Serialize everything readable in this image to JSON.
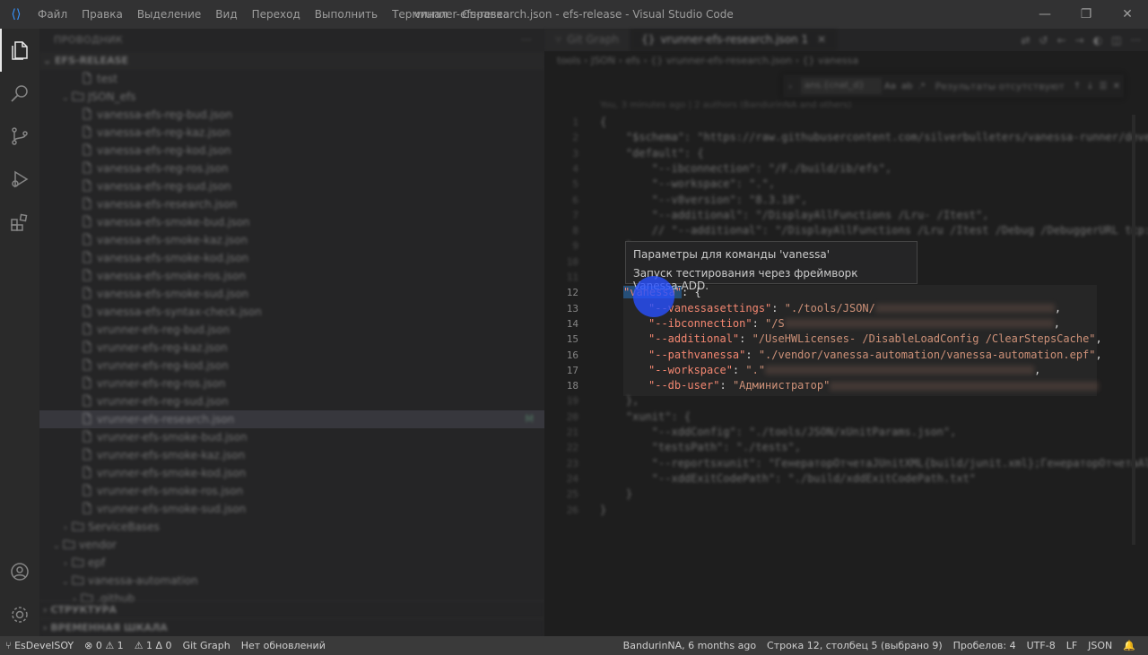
{
  "titlebar": {
    "menu": [
      "Файл",
      "Правка",
      "Выделение",
      "Вид",
      "Переход",
      "Выполнить",
      "Терминал",
      "Справка"
    ],
    "window_title": "vrunner-efs-research.json - efs-release - Visual Studio Code",
    "controls": [
      "—",
      "❐",
      "✕"
    ]
  },
  "activity": {
    "items": [
      "explorer-icon",
      "search-icon",
      "source-control-icon",
      "run-debug-icon",
      "extensions-icon"
    ],
    "bottom": [
      "account-icon",
      "settings-gear-icon"
    ]
  },
  "sidebar": {
    "header": "ПРОВОДНИК",
    "more": "···",
    "root": "EFS-RELEASE",
    "rows": [
      {
        "indent": 2,
        "chev": "",
        "label": "test"
      },
      {
        "indent": 1,
        "chev": "⌄",
        "label": "JSON_efs",
        "folder": true
      },
      {
        "indent": 2,
        "chev": "",
        "label": "vanessa-efs-reg-bud.json"
      },
      {
        "indent": 2,
        "chev": "",
        "label": "vanessa-efs-reg-kaz.json"
      },
      {
        "indent": 2,
        "chev": "",
        "label": "vanessa-efs-reg-kod.json"
      },
      {
        "indent": 2,
        "chev": "",
        "label": "vanessa-efs-reg-ros.json"
      },
      {
        "indent": 2,
        "chev": "",
        "label": "vanessa-efs-reg-sud.json"
      },
      {
        "indent": 2,
        "chev": "",
        "label": "vanessa-efs-research.json"
      },
      {
        "indent": 2,
        "chev": "",
        "label": "vanessa-efs-smoke-bud.json"
      },
      {
        "indent": 2,
        "chev": "",
        "label": "vanessa-efs-smoke-kaz.json"
      },
      {
        "indent": 2,
        "chev": "",
        "label": "vanessa-efs-smoke-kod.json"
      },
      {
        "indent": 2,
        "chev": "",
        "label": "vanessa-efs-smoke-ros.json"
      },
      {
        "indent": 2,
        "chev": "",
        "label": "vanessa-efs-smoke-sud.json"
      },
      {
        "indent": 2,
        "chev": "",
        "label": "vanessa-efs-syntax-check.json"
      },
      {
        "indent": 2,
        "chev": "",
        "label": "vrunner-efs-reg-bud.json"
      },
      {
        "indent": 2,
        "chev": "",
        "label": "vrunner-efs-reg-kaz.json"
      },
      {
        "indent": 2,
        "chev": "",
        "label": "vrunner-efs-reg-kod.json"
      },
      {
        "indent": 2,
        "chev": "",
        "label": "vrunner-efs-reg-ros.json"
      },
      {
        "indent": 2,
        "chev": "",
        "label": "vrunner-efs-reg-sud.json"
      },
      {
        "indent": 2,
        "chev": "",
        "label": "vrunner-efs-research.json",
        "selected": true,
        "badge": "M"
      },
      {
        "indent": 2,
        "chev": "",
        "label": "vrunner-efs-smoke-bud.json"
      },
      {
        "indent": 2,
        "chev": "",
        "label": "vrunner-efs-smoke-kaz.json"
      },
      {
        "indent": 2,
        "chev": "",
        "label": "vrunner-efs-smoke-kod.json"
      },
      {
        "indent": 2,
        "chev": "",
        "label": "vrunner-efs-smoke-ros.json"
      },
      {
        "indent": 2,
        "chev": "",
        "label": "vrunner-efs-smoke-sud.json"
      },
      {
        "indent": 1,
        "chev": "›",
        "label": "ServiceBases",
        "folder": true
      },
      {
        "indent": 0,
        "chev": "⌄",
        "label": "vendor",
        "folder": true
      },
      {
        "indent": 1,
        "chev": "›",
        "label": "epf",
        "folder": true
      },
      {
        "indent": 1,
        "chev": "⌄",
        "label": "vanessa-automation",
        "folder": true
      },
      {
        "indent": 2,
        "chev": "›",
        "label": ".github",
        "folder": true
      }
    ],
    "bottom_sections": [
      "СТРУКТУРА",
      "ВРЕМЕННАЯ ШКАЛА"
    ]
  },
  "editor": {
    "tabs": [
      {
        "label": "Git Graph",
        "active": false
      },
      {
        "label": "vrunner-efs-research.json 1",
        "active": true
      }
    ],
    "breadcrumbs": "tools › JSON › efs › {} vrunner-efs-research.json › {} vanessa",
    "find": {
      "value": "ans.{cnat_d}",
      "options": [
        "Aa",
        "ab",
        ".*"
      ],
      "result": "Результаты отсутствуют"
    },
    "blame": "You, 3 minutes ago | 2 authors (BandurinNA and others)",
    "hover": {
      "title": "Параметры для команды 'vanessa'",
      "description": "Запуск тестирования через фреймворк Vanessa-ADD."
    },
    "lines": [
      {
        "n": "1",
        "text": "{"
      },
      {
        "n": "2",
        "text": "    \"$schema\": \"https://raw.githubusercontent.com/silverbulleters/vanessa-runner/develop/vanessa-runner-schema.json\","
      },
      {
        "n": "3",
        "text": "    \"default\": {"
      },
      {
        "n": "4",
        "text": "        \"--ibconnection\": \"/F./build/ib/efs\","
      },
      {
        "n": "5",
        "text": "        \"--workspace\": \".\","
      },
      {
        "n": "6",
        "text": "        \"--v8version\": \"8.3.18\","
      },
      {
        "n": "7",
        "text": "        \"--additional\": \"/DisplayAllFunctions /Lru- /Itest\","
      },
      {
        "n": "8",
        "text": "        // \"--additional\": \"/DisplayAllFunctions /Lru /Itest /Debug /DebuggerURL tcp://localhost\","
      },
      {
        "n": "9",
        "text": "    },"
      },
      {
        "n": "10",
        "text": ""
      },
      {
        "n": "11",
        "text": ""
      },
      {
        "n": "12",
        "text": "    \"vanessa\": {",
        "special": "vanessa"
      },
      {
        "n": "13",
        "key": "\"--vanessasettings\"",
        "val": "\"./tools/JSON/",
        "tail": ","
      },
      {
        "n": "14",
        "key": "\"--ibconnection\"",
        "val": "\"/S",
        "tail": ","
      },
      {
        "n": "15",
        "key": "\"--additional\"",
        "val": "\"/UseHWLicenses- /DisableLoadConfig /ClearStepsCache\"",
        "tail": ","
      },
      {
        "n": "16",
        "key": "\"--pathvanessa\"",
        "val": "\"./vendor/vanessa-automation/vanessa-automation.epf\"",
        "tail": ","
      },
      {
        "n": "17",
        "key": "\"--workspace\"",
        "val": "\".\"",
        "tail": ","
      },
      {
        "n": "18",
        "key": "\"--db-user\"",
        "val": "\"Администратор\"",
        "tail": ""
      },
      {
        "n": "19",
        "text": "    },"
      },
      {
        "n": "20",
        "text": "    \"xunit\": {"
      },
      {
        "n": "21",
        "text": "        \"--xddConfig\": \"./tools/JSON/xUnitParams.json\","
      },
      {
        "n": "22",
        "text": "        \"testsPath\": \"./tests\","
      },
      {
        "n": "23",
        "text": "        \"--reportsxunit\": \"ГенераторОтчетаJUnitXML{build/junit.xml};ГенераторОтчетаAllureXML\","
      },
      {
        "n": "24",
        "text": "        \"--xddExitCodePath\": \"./build/xddExitCodePath.txt\""
      },
      {
        "n": "25",
        "text": "    }"
      },
      {
        "n": "26",
        "text": "}"
      }
    ]
  },
  "statusbar": {
    "left": [
      "⑂ EsDevelSOY",
      "⊗ 0 ⚠ 1",
      "⚠ 1 Δ 0",
      "Git Graph",
      "Нет обновлений"
    ],
    "right": [
      "BandurinNA, 6 months ago",
      "Строка 12, столбец 5 (выбрано 9)",
      "Пробелов: 4",
      "UTF-8",
      "LF",
      "JSON",
      "🔔"
    ]
  },
  "colors": {
    "accent": "#3794ff",
    "key": "#f48771",
    "string": "#ce9178",
    "cursor": "#2850ff"
  }
}
